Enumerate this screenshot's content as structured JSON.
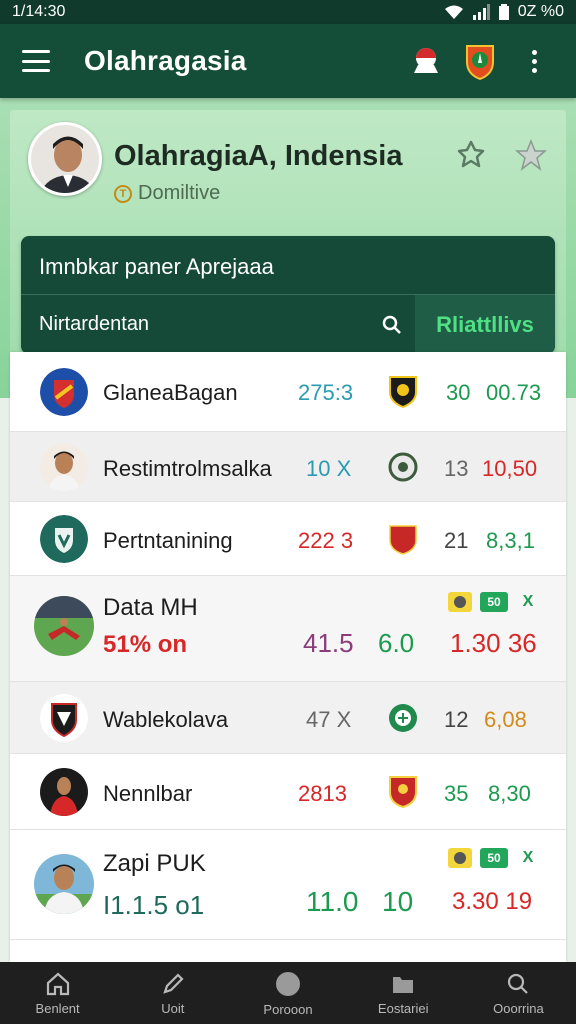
{
  "status": {
    "time": "1/14:30",
    "battery": "0Z %0"
  },
  "app_bar": {
    "title": "Olahragasia"
  },
  "profile": {
    "name": "OlahragiaA, Indensia",
    "subtitle": "Domiltive"
  },
  "search": {
    "heading": "Imnbkar paner Aprejaaa",
    "placeholder": "Nirtardentan",
    "filter_label": "Rliattllivs"
  },
  "rows": [
    {
      "name": "GlaneaBagan",
      "v1": "275:3",
      "v2": "30",
      "v3": "00.73",
      "colors": {
        "v1": "#2a9bb0",
        "v2": "#1c9a4f",
        "v3": "#1c9a4f"
      }
    },
    {
      "name": "Restimtrolmsalka",
      "v1": "10 X",
      "v2": "13",
      "v3": "10,50",
      "colors": {
        "v1": "#2a9bb0",
        "v2": "#666666",
        "v3": "#d62828"
      }
    },
    {
      "name": "Pertntanining",
      "v1": "222 3",
      "v2": "21",
      "v3": "8,3,1",
      "colors": {
        "v1": "#d62828",
        "v2": "#444444",
        "v3": "#1c9a4f"
      }
    },
    {
      "name": "Data MH",
      "sub": "51% on",
      "v1": "41.5",
      "v2": "6.0",
      "v3": "1.30 36",
      "mini": [
        "",
        "50",
        "X"
      ],
      "colors": {
        "v1": "#8a3d7a",
        "v2": "#1c9a4f",
        "v3": "#d62828"
      }
    },
    {
      "name": "Wablekolava",
      "v1": "47 X",
      "v2": "12",
      "v3": "6,08",
      "colors": {
        "v1": "#666666",
        "v2": "#444444",
        "v3": "#d28a1a"
      }
    },
    {
      "name": "Nennlbar",
      "v1": "2813",
      "v2": "35",
      "v3": "8,30",
      "colors": {
        "v1": "#d62828",
        "v2": "#1c9a4f",
        "v3": "#1c9a4f"
      }
    },
    {
      "name": "Zapi PUK",
      "sub": "I1.1.5 o1",
      "v1": "11.0",
      "v2": "10",
      "v3": "3.30 19",
      "mini": [
        "",
        "50",
        "X"
      ],
      "colors": {
        "v1": "#1c9a4f",
        "v2": "#1c9a4f",
        "v3": "#d62828"
      }
    }
  ],
  "nav": [
    {
      "label": "Benlent",
      "icon": "home-icon"
    },
    {
      "label": "Uoit",
      "icon": "edit-icon"
    },
    {
      "label": "Porooon",
      "icon": "circle-icon"
    },
    {
      "label": "Eostariei",
      "icon": "folder-icon"
    },
    {
      "label": "Ooorrina",
      "icon": "search-icon"
    }
  ]
}
